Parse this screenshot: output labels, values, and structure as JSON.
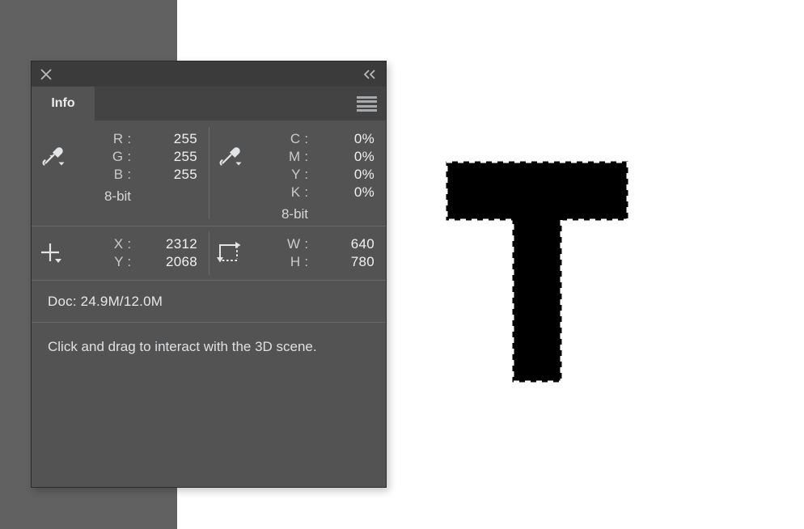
{
  "canvas": {
    "background_color": "#ffffff",
    "gray_region_color": "#616161",
    "artwork": {
      "name": "letter-t-selection",
      "fill_color": "#000000",
      "selection_style": "marching-ants-dashed"
    }
  },
  "panel": {
    "title_bar": {
      "close_icon": "close-icon",
      "collapse_icon": "double-chevron-left-icon"
    },
    "tabs": [
      {
        "label": "Info",
        "active": true
      }
    ],
    "menu_icon": "hamburger-menu-icon",
    "color_readouts": [
      {
        "icon": "eyedropper-icon",
        "rows": [
          {
            "label": "R :",
            "value": "255"
          },
          {
            "label": "G :",
            "value": "255"
          },
          {
            "label": "B :",
            "value": "255"
          }
        ],
        "depth": "8-bit"
      },
      {
        "icon": "eyedropper-icon",
        "rows": [
          {
            "label": "C :",
            "value": "0%"
          },
          {
            "label": "M :",
            "value": "0%"
          },
          {
            "label": "Y :",
            "value": "0%"
          },
          {
            "label": "K :",
            "value": "0%"
          }
        ],
        "depth": "8-bit"
      }
    ],
    "coordinate_readouts": [
      {
        "icon": "crosshair-icon",
        "rows": [
          {
            "label": "X :",
            "value": "2312"
          },
          {
            "label": "Y :",
            "value": "2068"
          }
        ]
      },
      {
        "icon": "selection-size-icon",
        "rows": [
          {
            "label": "W :",
            "value": "640"
          },
          {
            "label": "H :",
            "value": "780"
          }
        ]
      }
    ],
    "doc_status": "Doc: 24.9M/12.0M",
    "hint_text": "Click and drag to interact with the 3D scene."
  }
}
